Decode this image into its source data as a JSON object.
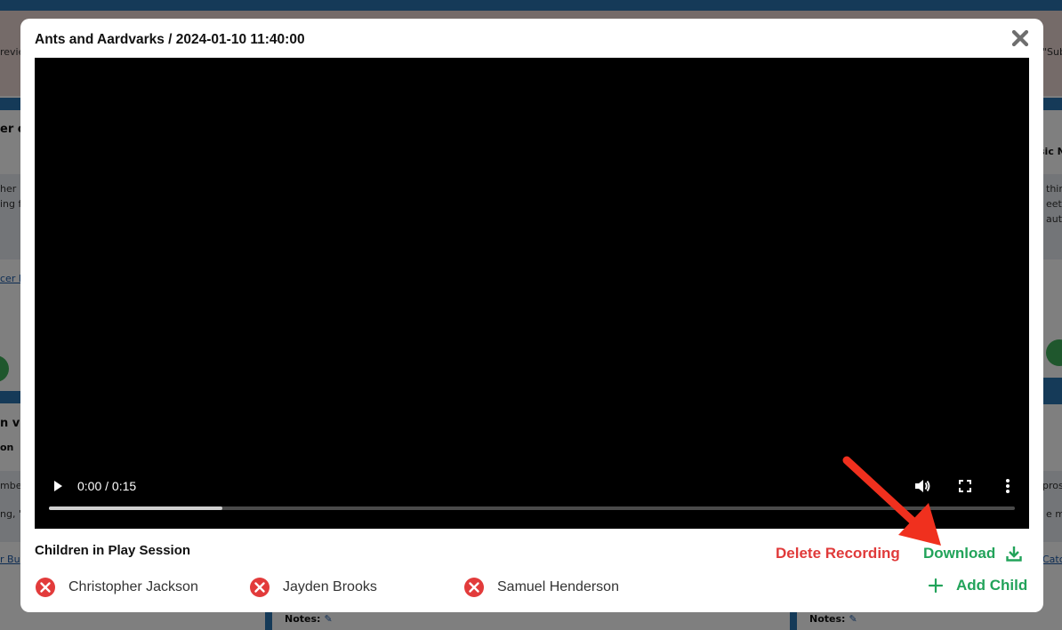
{
  "background": {
    "fragments": {
      "left_1": "revie",
      "right_1": "\"Sub",
      "left_heading_1": "er c",
      "right_heading_1": "sic N",
      "left_lines_1": [
        "her",
        "ing f"
      ],
      "right_lines_1": [
        "thin",
        "eeti",
        "aut"
      ],
      "left_link_1": "cer l",
      "left_heading_2": "n vie",
      "left_sub_2": "on",
      "left_lines_2": [
        "mbe",
        "ng, \""
      ],
      "right_lines_2": [
        "pros",
        "e ma"
      ],
      "left_link_2": "r Bu",
      "right_link_2": "Catc",
      "notes_label": "Notes:"
    }
  },
  "modal": {
    "title": "Ants and Aardvarks / 2024-01-10 11:40:00",
    "video": {
      "time": "0:00 / 0:15",
      "progress": 0.18
    },
    "children_heading": "Children in Play Session",
    "delete_label": "Delete Recording",
    "download_label": "Download",
    "add_child_label": "Add Child",
    "children": [
      {
        "name": "Christopher Jackson"
      },
      {
        "name": "Jayden Brooks"
      },
      {
        "name": "Samuel Henderson"
      }
    ]
  },
  "colors": {
    "danger": "#e03a3a",
    "success": "#22a35a",
    "brand_blue": "#2a74b0",
    "annotation_arrow": "#f0301e"
  },
  "icons": {
    "close": "close-icon",
    "play": "play-icon",
    "volume": "volume-icon",
    "fullscreen": "fullscreen-icon",
    "more": "more-vertical-icon",
    "download": "download-icon",
    "remove": "remove-circle-icon",
    "add": "plus-icon"
  }
}
